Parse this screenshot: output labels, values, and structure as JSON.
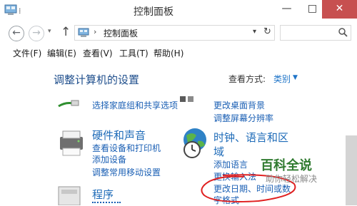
{
  "window": {
    "title": "控制面板",
    "min_glyph": "—",
    "max_glyph": "□",
    "close_glyph": "✕",
    "qat_glyph": "⁞"
  },
  "nav": {
    "back_glyph": "←",
    "forward_glyph": "→",
    "recent_glyph": "▾",
    "up_glyph": "↑",
    "address_chevron": "›",
    "address": "控制面板",
    "address_dropdown": "▾",
    "refresh_glyph": "↻"
  },
  "menu": [
    "文件(F)",
    "编辑(E)",
    "查看(V)",
    "工具(T)",
    "帮助(H)"
  ],
  "content": {
    "heading": "调整计算机的设置",
    "view_by_label": "查看方式:",
    "view_by_value": "类别",
    "view_by_caret": "▼",
    "left_top_link": "选择家庭组和共享选项",
    "hardware": {
      "title": "硬件和声音",
      "links": [
        "查看设备和打印机",
        "添加设备",
        "调整常用移动设置"
      ]
    },
    "programs": {
      "title": "程序"
    },
    "appearance_links": [
      "更改桌面背景",
      "调整屏幕分辨率"
    ],
    "clock": {
      "title_line1": "时钟、语言和区",
      "title_line2": "域",
      "links": [
        "添加语言",
        "更换输入法",
        "更改日期、时间或数",
        "字格式"
      ]
    }
  },
  "watermark": {
    "logo": "百科全说",
    "sub": "助你轻松解决"
  },
  "colors": {
    "close_button": "#c75050",
    "link": "#1a5fb4",
    "heading": "#1e4e8c",
    "annotation": "#e02020"
  }
}
